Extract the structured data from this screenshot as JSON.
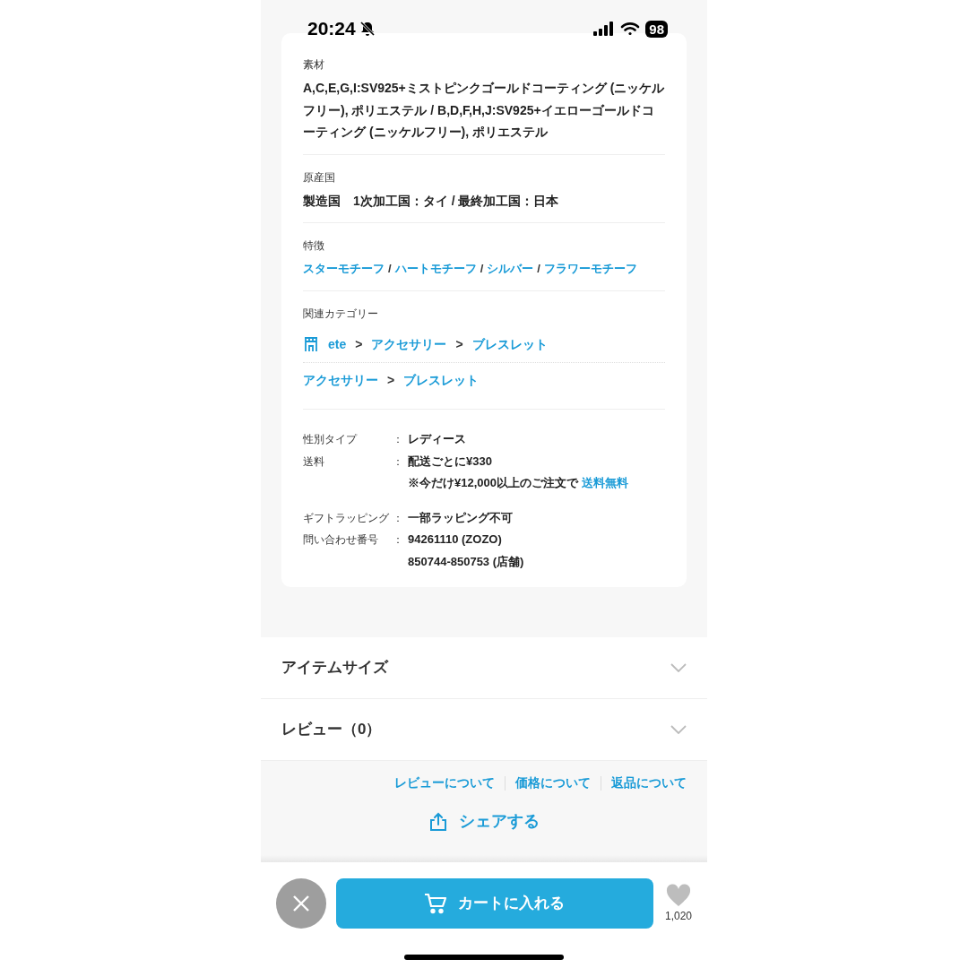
{
  "status_bar": {
    "time": "20:24",
    "battery": "98"
  },
  "spec_sections": [
    {
      "label": "素材",
      "kind": "text",
      "value": "A,C,E,G,I:SV925+ミストピンクゴールドコーティング (ニッケルフリー), ポリエステル / B,D,F,H,J:SV925+イエローゴールドコーティング (ニッケルフリー), ポリエステル"
    },
    {
      "label": "原産国",
      "kind": "text",
      "value": "製造国　1次加工国：タイ / 最終加工国：日本"
    },
    {
      "label": "特徴",
      "kind": "links",
      "items": [
        {
          "kind": "link",
          "text": "スターモチーフ"
        },
        {
          "kind": "separator",
          "text": "/"
        },
        {
          "kind": "link",
          "text": "ハートモチーフ"
        },
        {
          "kind": "separator",
          "text": "/"
        },
        {
          "kind": "link",
          "text": "シルバー"
        },
        {
          "kind": "separator",
          "text": "/"
        },
        {
          "kind": "link",
          "text": "フラワーモチーフ"
        }
      ]
    },
    {
      "label": "関連カテゴリー",
      "kind": "breadcrumbs",
      "rows": [
        {
          "shop_icon": true,
          "items": [
            {
              "kind": "link",
              "text": "ete"
            },
            {
              "kind": "separator",
              "text": ">"
            },
            {
              "kind": "link",
              "text": "アクセサリー"
            },
            {
              "kind": "separator",
              "text": ">"
            },
            {
              "kind": "link",
              "text": "ブレスレット"
            }
          ]
        },
        {
          "shop_icon": false,
          "items": [
            {
              "kind": "link",
              "text": "アクセサリー"
            },
            {
              "kind": "separator",
              "text": ">"
            },
            {
              "kind": "link",
              "text": "ブレスレット"
            }
          ]
        }
      ]
    }
  ],
  "detail_groups": [
    [
      {
        "label": "性別タイプ",
        "colon": "：",
        "lines": [
          {
            "text": "レディース"
          }
        ]
      },
      {
        "label": "送料",
        "colon": "：",
        "lines": [
          {
            "text": "配送ごとに¥330"
          },
          {
            "text": "※今だけ¥12,000以上のご注文で",
            "link": "送料無料"
          }
        ]
      }
    ],
    [
      {
        "label": "ギフトラッピング",
        "colon": "：",
        "lines": [
          {
            "text": "一部ラッピング不可"
          }
        ]
      },
      {
        "label": "問い合わせ番号",
        "colon": "：",
        "lines": [
          {
            "text": "94261110 (ZOZO)"
          },
          {
            "text": "850744-850753 (店舗)"
          }
        ]
      }
    ]
  ],
  "accordions": [
    {
      "title": "アイテムサイズ",
      "expanded": false
    },
    {
      "title": "レビュー（0）",
      "expanded": false
    }
  ],
  "footer_links": [
    "レビューについて",
    "価格について",
    "返品について"
  ],
  "share_button": "シェアする",
  "bottom_bar": {
    "cart_button": "カートに入れる",
    "favorite_count": "1,020"
  }
}
